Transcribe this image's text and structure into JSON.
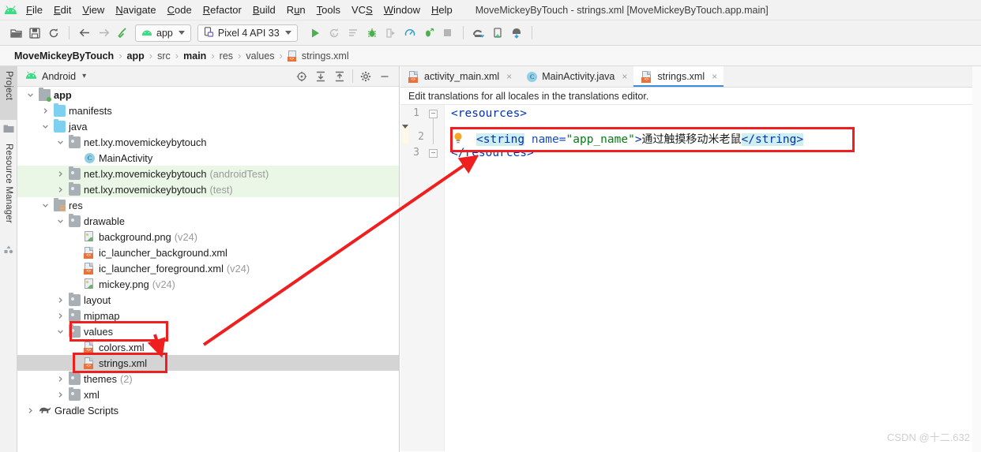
{
  "window": {
    "title": "MoveMickeyByTouch - strings.xml [MoveMickeyByTouch.app.main]",
    "logo_icon": "android-logo-icon"
  },
  "menubar": {
    "items": [
      {
        "label": "File",
        "mnemonic": "F"
      },
      {
        "label": "Edit",
        "mnemonic": "E"
      },
      {
        "label": "View",
        "mnemonic": "V"
      },
      {
        "label": "Navigate",
        "mnemonic": "N"
      },
      {
        "label": "Code",
        "mnemonic": "C"
      },
      {
        "label": "Refactor",
        "mnemonic": "R"
      },
      {
        "label": "Build",
        "mnemonic": "B"
      },
      {
        "label": "Run",
        "mnemonic": "u"
      },
      {
        "label": "Tools",
        "mnemonic": "T"
      },
      {
        "label": "VCS",
        "mnemonic": "S"
      },
      {
        "label": "Window",
        "mnemonic": "W"
      },
      {
        "label": "Help",
        "mnemonic": "H"
      }
    ]
  },
  "toolbar": {
    "icons": [
      "open-folder-icon",
      "save-all-icon",
      "sync-refresh-icon",
      "back-arrow-icon",
      "forward-arrow-icon",
      "build-hammer-icon"
    ],
    "module_selector": {
      "label": "app",
      "icon": "android-module-icon"
    },
    "device_selector": {
      "label": "Pixel 4 API 33",
      "icon": "device-phone-icon"
    },
    "run_icons": [
      "run-icon",
      "apply-changes-icon",
      "apply-code-changes-icon",
      "debug-icon",
      "attach-debugger-icon",
      "profiler-icon",
      "run-with-coverage-icon",
      "stop-icon"
    ],
    "right_icons": [
      "sdk-manager-icon",
      "avd-manager-icon",
      "sync-gradle-icon"
    ]
  },
  "breadcrumb": {
    "items": [
      {
        "label": "MoveMickeyByTouch",
        "bold": true
      },
      {
        "label": "app",
        "bold": true
      },
      {
        "label": "src",
        "bold": false
      },
      {
        "label": "main",
        "bold": true
      },
      {
        "label": "res",
        "bold": false
      },
      {
        "label": "values",
        "bold": false
      },
      {
        "label": "strings.xml",
        "bold": false,
        "icon": "xml-file-icon"
      }
    ],
    "separator": "›"
  },
  "tool_window_tabs": [
    {
      "label": "Project",
      "selected": true,
      "icon": "project-folder-icon"
    },
    {
      "label": "Resource Manager",
      "selected": false,
      "icon": "resource-manager-icon"
    }
  ],
  "project_panel": {
    "title": "Android",
    "title_icon": "android-head-icon",
    "dropdown_caret": "▾",
    "header_icons": [
      "select-opened-file-icon",
      "expand-all-icon",
      "collapse-all-icon",
      "settings-gear-icon",
      "hide-minimize-icon"
    ],
    "tree": [
      {
        "depth": 0,
        "twisty": "down",
        "icon": "module-folder-icon",
        "label": "app",
        "bold": true,
        "dim": "",
        "highlight": "none"
      },
      {
        "depth": 1,
        "twisty": "right",
        "icon": "folder-blue-icon",
        "label": "manifests",
        "bold": false,
        "dim": "",
        "highlight": "none"
      },
      {
        "depth": 1,
        "twisty": "down",
        "icon": "folder-blue-icon",
        "label": "java",
        "bold": false,
        "dim": "",
        "highlight": "none"
      },
      {
        "depth": 2,
        "twisty": "down",
        "icon": "package-folder-icon",
        "label": "net.lxy.movemickeybytouch",
        "bold": false,
        "dim": "",
        "highlight": "none"
      },
      {
        "depth": 3,
        "twisty": "none",
        "icon": "java-class-icon",
        "label": "MainActivity",
        "bold": false,
        "dim": "",
        "highlight": "none"
      },
      {
        "depth": 2,
        "twisty": "right",
        "icon": "package-folder-icon",
        "label": "net.lxy.movemickeybytouch",
        "bold": false,
        "dim": "(androidTest)",
        "highlight": "green"
      },
      {
        "depth": 2,
        "twisty": "right",
        "icon": "package-folder-icon",
        "label": "net.lxy.movemickeybytouch",
        "bold": false,
        "dim": "(test)",
        "highlight": "green"
      },
      {
        "depth": 1,
        "twisty": "down",
        "icon": "res-folder-icon",
        "label": "res",
        "bold": false,
        "dim": "",
        "highlight": "none"
      },
      {
        "depth": 2,
        "twisty": "down",
        "icon": "package-folder-icon",
        "label": "drawable",
        "bold": false,
        "dim": "",
        "highlight": "none"
      },
      {
        "depth": 3,
        "twisty": "none",
        "icon": "png-file-icon",
        "label": "background.png",
        "bold": false,
        "dim": "(v24)",
        "highlight": "none"
      },
      {
        "depth": 3,
        "twisty": "none",
        "icon": "xml-file-icon",
        "label": "ic_launcher_background.xml",
        "bold": false,
        "dim": "",
        "highlight": "none"
      },
      {
        "depth": 3,
        "twisty": "none",
        "icon": "xml-file-icon",
        "label": "ic_launcher_foreground.xml",
        "bold": false,
        "dim": "(v24)",
        "highlight": "none"
      },
      {
        "depth": 3,
        "twisty": "none",
        "icon": "png-file-icon",
        "label": "mickey.png",
        "bold": false,
        "dim": "(v24)",
        "highlight": "none"
      },
      {
        "depth": 2,
        "twisty": "right",
        "icon": "package-folder-icon",
        "label": "layout",
        "bold": false,
        "dim": "",
        "highlight": "none"
      },
      {
        "depth": 2,
        "twisty": "right",
        "icon": "package-folder-icon",
        "label": "mipmap",
        "bold": false,
        "dim": "",
        "highlight": "none"
      },
      {
        "depth": 2,
        "twisty": "down",
        "icon": "package-folder-icon",
        "label": "values",
        "bold": false,
        "dim": "",
        "highlight": "none"
      },
      {
        "depth": 3,
        "twisty": "none",
        "icon": "xml-file-icon",
        "label": "colors.xml",
        "bold": false,
        "dim": "",
        "highlight": "none"
      },
      {
        "depth": 3,
        "twisty": "none",
        "icon": "xml-file-icon",
        "label": "strings.xml",
        "bold": false,
        "dim": "",
        "highlight": "selected"
      },
      {
        "depth": 2,
        "twisty": "right",
        "icon": "package-folder-icon",
        "label": "themes",
        "bold": false,
        "dim": "(2)",
        "highlight": "none"
      },
      {
        "depth": 2,
        "twisty": "right",
        "icon": "package-folder-icon",
        "label": "xml",
        "bold": false,
        "dim": "",
        "highlight": "none"
      },
      {
        "depth": 0,
        "twisty": "right",
        "icon": "gradle-elephant-icon",
        "label": "Gradle Scripts",
        "bold": false,
        "dim": "",
        "highlight": "none"
      }
    ]
  },
  "editor": {
    "tabs": [
      {
        "label": "activity_main.xml",
        "icon": "xml-file-icon",
        "active": false,
        "close": "×"
      },
      {
        "label": "MainActivity.java",
        "icon": "java-class-icon",
        "active": false,
        "close": "×"
      },
      {
        "label": "strings.xml",
        "icon": "xml-file-icon",
        "active": true,
        "close": "×"
      }
    ],
    "notice": "Edit translations for all locales in the translations editor.",
    "lines": [
      {
        "num": "1",
        "indent": false,
        "caret": false,
        "fold": "minus",
        "bulb": false,
        "segments": [
          {
            "t": "<resources>",
            "k": "tag"
          }
        ]
      },
      {
        "num": "2",
        "indent": true,
        "caret": true,
        "fold": "none",
        "bulb": true,
        "segments": [
          {
            "t": "<string",
            "k": "tag-highlight"
          },
          {
            "t": " name=",
            "k": "attr"
          },
          {
            "t": "\"app_name\"",
            "k": "string"
          },
          {
            "t": ">",
            "k": "tag"
          },
          {
            "t": "通过触摸移动米老鼠",
            "k": "text"
          },
          {
            "t": "</string>",
            "k": "tag-highlight"
          }
        ]
      },
      {
        "num": "3",
        "indent": false,
        "caret": false,
        "fold": "minus",
        "bulb": false,
        "segments": [
          {
            "t": "</resources>",
            "k": "tag"
          }
        ]
      }
    ]
  },
  "annotations": {
    "color": "#f01f1f",
    "boxes": [
      {
        "name": "values-folder-highlight-box"
      },
      {
        "name": "strings-xml-highlight-box"
      },
      {
        "name": "code-line-highlight-box"
      }
    ],
    "arrows": [
      {
        "name": "long-arrow-tree-to-code"
      },
      {
        "name": "short-arrow-to-strings-xml"
      }
    ]
  },
  "watermark": {
    "text": "CSDN @十二.632"
  }
}
